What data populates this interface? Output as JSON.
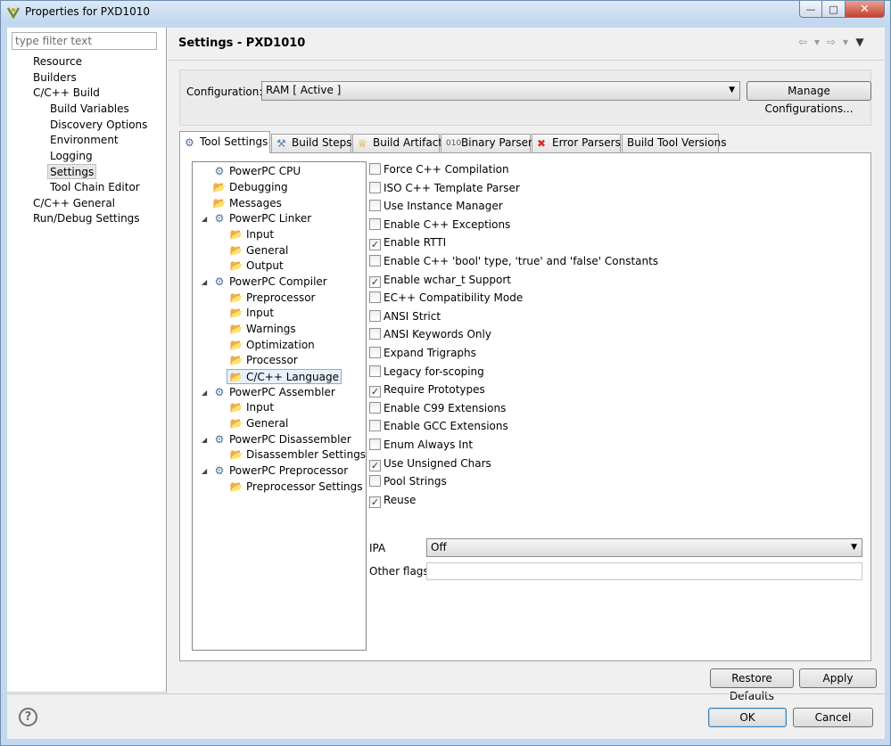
{
  "window": {
    "title": "Properties for PXD1010"
  },
  "filter": {
    "placeholder": "type filter text"
  },
  "nav": {
    "items": [
      {
        "label": "Resource"
      },
      {
        "label": "Builders"
      },
      {
        "label": "C/C++ Build"
      },
      {
        "label": "Build Variables"
      },
      {
        "label": "Discovery Options"
      },
      {
        "label": "Environment"
      },
      {
        "label": "Logging"
      },
      {
        "label": "Settings"
      },
      {
        "label": "Tool Chain Editor"
      },
      {
        "label": "C/C++ General"
      },
      {
        "label": "Run/Debug Settings"
      }
    ]
  },
  "page": {
    "title": "Settings - PXD1010"
  },
  "config": {
    "label": "Configuration:",
    "value": "RAM  [ Active ]",
    "manage_label": "Manage Configurations..."
  },
  "tabs": [
    {
      "label": "Tool Settings"
    },
    {
      "label": "Build Steps"
    },
    {
      "label": "Build Artifact"
    },
    {
      "label": "Binary Parsers"
    },
    {
      "label": "Error Parsers"
    },
    {
      "label": "Build Tool Versions"
    }
  ],
  "tree": [
    {
      "label": "PowerPC CPU"
    },
    {
      "label": "Debugging"
    },
    {
      "label": "Messages"
    },
    {
      "label": "PowerPC Linker"
    },
    {
      "label": "Input"
    },
    {
      "label": "General"
    },
    {
      "label": "Output"
    },
    {
      "label": "PowerPC Compiler"
    },
    {
      "label": "Preprocessor"
    },
    {
      "label": "Input"
    },
    {
      "label": "Warnings"
    },
    {
      "label": "Optimization"
    },
    {
      "label": "Processor"
    },
    {
      "label": "C/C++ Language"
    },
    {
      "label": "PowerPC Assembler"
    },
    {
      "label": "Input"
    },
    {
      "label": "General"
    },
    {
      "label": "PowerPC Disassembler"
    },
    {
      "label": "Disassembler Settings"
    },
    {
      "label": "PowerPC Preprocessor"
    },
    {
      "label": "Preprocessor Settings"
    }
  ],
  "options": [
    {
      "label": "Force C++ Compilation",
      "checked": false
    },
    {
      "label": "ISO C++ Template Parser",
      "checked": false
    },
    {
      "label": "Use Instance Manager",
      "checked": false
    },
    {
      "label": "Enable C++ Exceptions",
      "checked": false
    },
    {
      "label": "Enable RTTI",
      "checked": true
    },
    {
      "label": "Enable C++ 'bool' type, 'true' and 'false' Constants",
      "checked": false
    },
    {
      "label": "Enable wchar_t Support",
      "checked": true
    },
    {
      "label": "EC++ Compatibility Mode",
      "checked": false
    },
    {
      "label": "ANSI Strict",
      "checked": false
    },
    {
      "label": "ANSI Keywords Only",
      "checked": false
    },
    {
      "label": "Expand Trigraphs",
      "checked": false
    },
    {
      "label": "Legacy for-scoping",
      "checked": false
    },
    {
      "label": "Require Prototypes",
      "checked": true
    },
    {
      "label": "Enable C99 Extensions",
      "checked": false
    },
    {
      "label": "Enable GCC Extensions",
      "checked": false
    },
    {
      "label": "Enum Always Int",
      "checked": false
    },
    {
      "label": "Use Unsigned Chars",
      "checked": true
    },
    {
      "label": "Pool Strings",
      "checked": false
    },
    {
      "label": "Reuse",
      "checked": true
    }
  ],
  "ipa": {
    "label": "IPA",
    "value": "Off"
  },
  "other_flags": {
    "label": "Other flags",
    "value": ""
  },
  "buttons": {
    "restore": "Restore Defaults",
    "apply": "Apply",
    "ok": "OK",
    "cancel": "Cancel"
  },
  "help": {
    "symbol": "?"
  }
}
